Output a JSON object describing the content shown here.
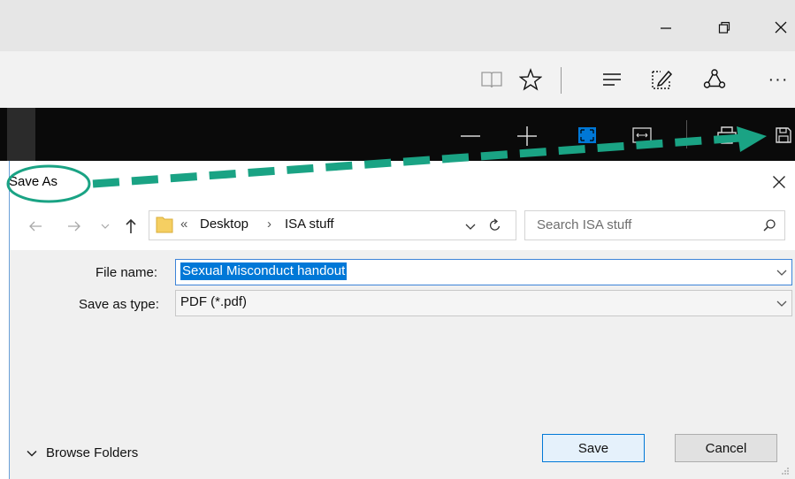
{
  "window_controls": {
    "minimize_icon": "minimize-icon",
    "restore_icon": "restore-icon",
    "close_icon": "close-icon"
  },
  "browser_toolbar": {
    "icons": [
      "reading-view-icon",
      "favorites-star-icon",
      "hub-icon",
      "web-note-icon",
      "share-icon",
      "more-icon"
    ],
    "more_label": "···"
  },
  "pdf_toolbar": {
    "icons": [
      "zoom-out-icon",
      "zoom-in-icon",
      "fit-page-icon",
      "fit-width-icon",
      "print-icon",
      "save-icon"
    ],
    "accent": "#0078d7"
  },
  "dialog": {
    "title": "Save As",
    "breadcrumb": {
      "overflow": "«",
      "folder": "Desktop",
      "separator": "›",
      "subfolder": "ISA stuff"
    },
    "search_placeholder": "Search ISA stuff",
    "file_name_label": "File name:",
    "file_name_value": "Sexual Misconduct handout",
    "save_type_label": "Save as type:",
    "save_type_value": "PDF (*.pdf)",
    "browse_folders": "Browse Folders",
    "save_button": "Save",
    "cancel_button": "Cancel"
  },
  "annotation": {
    "color": "#1aa384"
  }
}
